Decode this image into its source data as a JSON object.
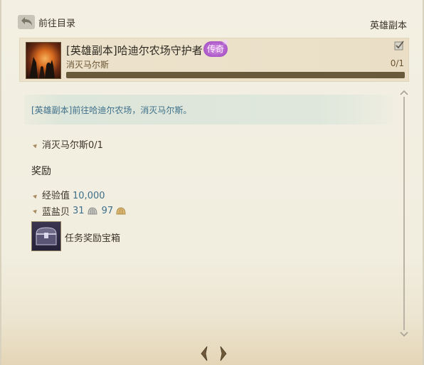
{
  "nav": {
    "back_label": "前往目录",
    "category": "英雄副本"
  },
  "quest": {
    "title": "[英雄副本]哈迪尔农场守护者",
    "grade_badge": "传奇",
    "objective_short": "消灭马尔斯",
    "progress_text": "0/1",
    "progress_fraction": 0.0
  },
  "description": "[英雄副本]前往哈迪尔农场，消灭马尔斯。",
  "objectives": [
    {
      "label": "消灭马尔斯0/1"
    }
  ],
  "rewards": {
    "title": "奖励",
    "exp_label": "经验值",
    "exp_value": "10,000",
    "shell_label": "蓝盐贝",
    "shell_silver": "31",
    "shell_gold": "97",
    "item_label": "任务奖励宝箱"
  },
  "colors": {
    "accent_blue": "#3f6f8a",
    "legend_purple": "#b15fcc",
    "progress_track": "#6a5a3c"
  },
  "icons": [
    "back-arrow-icon",
    "quest-portrait",
    "checkbox-icon",
    "silver-shell-icon",
    "gold-shell-icon",
    "treasure-chest-icon",
    "scroll-up-icon",
    "scroll-down-icon",
    "prev-page-icon",
    "next-page-icon"
  ]
}
